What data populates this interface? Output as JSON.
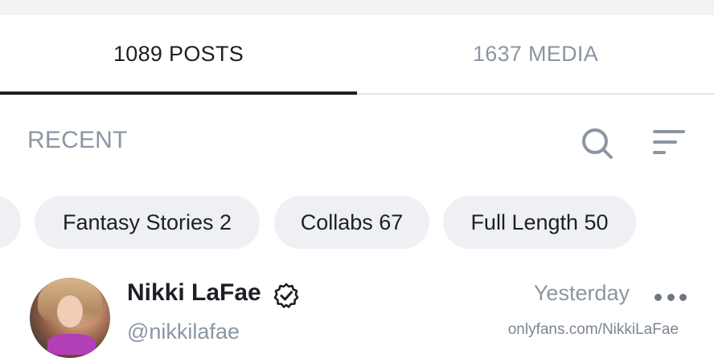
{
  "tabs": [
    {
      "label": "1089 POSTS",
      "active": true
    },
    {
      "label": "1637 MEDIA",
      "active": false
    }
  ],
  "toolbar": {
    "section_label": "RECENT",
    "search_icon": "search-icon",
    "sort_icon": "sort-icon"
  },
  "chips": [
    {
      "label": ""
    },
    {
      "label": "Fantasy Stories 2"
    },
    {
      "label": "Collabs 67"
    },
    {
      "label": "Full Length 50"
    }
  ],
  "post": {
    "author_name": "Nikki LaFae",
    "verified": true,
    "handle": "@nikkilafae",
    "timestamp": "Yesterday",
    "more_icon": "more-icon",
    "watermark": "onlyfans.com/NikkiLaFae"
  },
  "colors": {
    "text_primary": "#1c1f24",
    "text_muted": "#8a96a3",
    "chip_bg": "#eef0f3",
    "divider": "#e3e6ea"
  }
}
